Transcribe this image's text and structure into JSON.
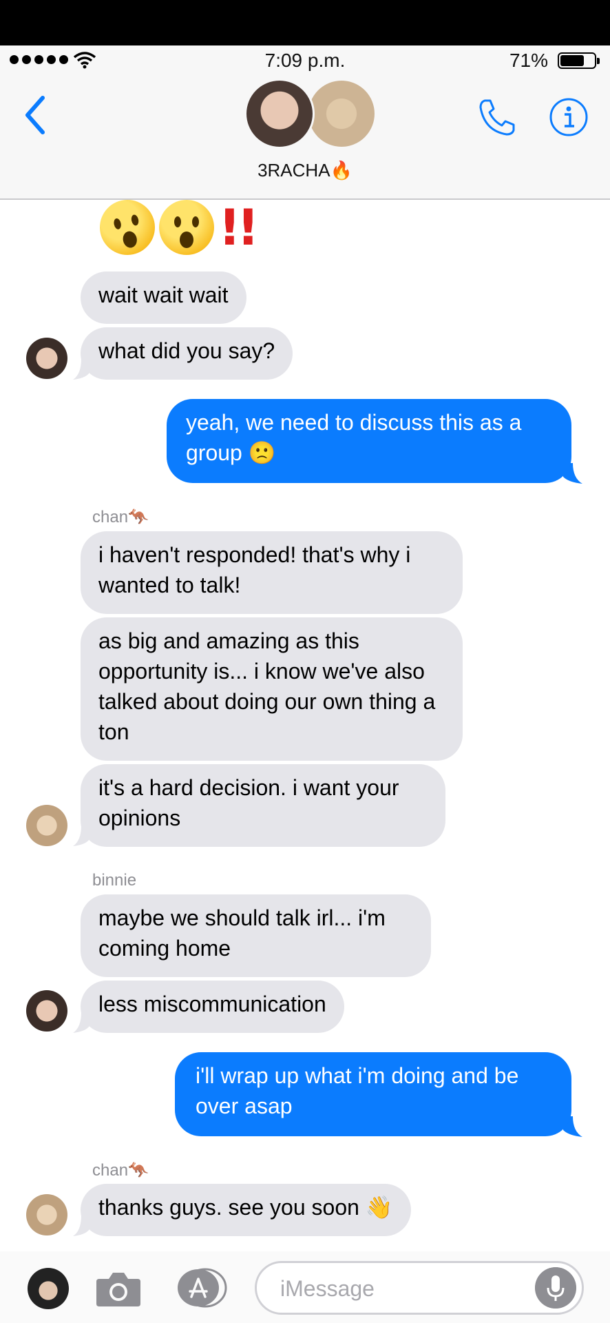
{
  "status_bar": {
    "time": "7:09 p.m.",
    "battery_percent": "71%",
    "battery_level": 0.71
  },
  "header": {
    "group_name": "3RACHA🔥"
  },
  "colors": {
    "accent": "#0b7cfe",
    "incoming_bubble": "#e5e5ea",
    "header_bg": "#f7f7f7"
  },
  "emoji_message": {
    "marks": "!!"
  },
  "messages": [
    {
      "from": "them",
      "text": "wait wait wait"
    },
    {
      "from": "them",
      "text": "what did you say?"
    },
    {
      "from": "me",
      "text": "yeah, we need to discuss this as a group 🙁"
    },
    {
      "sender": "chan🦘",
      "from": "them",
      "text": "i haven't responded! that's why i wanted to talk!"
    },
    {
      "from": "them",
      "text": "as big and amazing as this opportunity is... i know we've also talked about doing our own thing a ton"
    },
    {
      "from": "them",
      "text": "it's a hard decision. i want your opinions"
    },
    {
      "sender": "binnie",
      "from": "them",
      "text": "maybe we should talk irl... i'm coming home"
    },
    {
      "from": "them",
      "text": "less miscommunication"
    },
    {
      "from": "me",
      "text": "i'll wrap up what i'm doing and be over asap"
    },
    {
      "sender": "chan🦘",
      "from": "them",
      "text": "thanks guys. see you soon 👋"
    }
  ],
  "input": {
    "placeholder": "iMessage"
  }
}
